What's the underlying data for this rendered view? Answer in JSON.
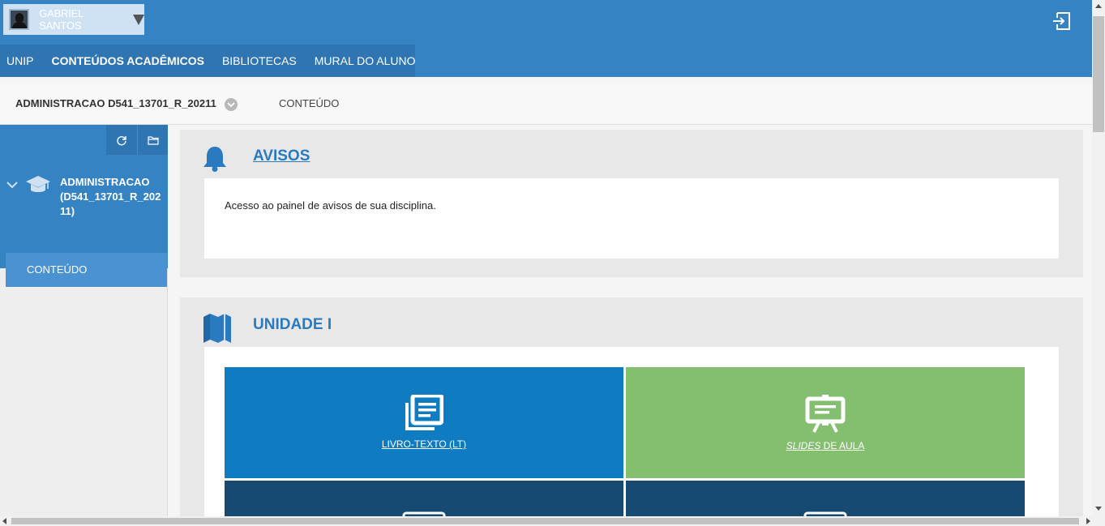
{
  "header": {
    "user_name": "GABRIEL SANTOS",
    "nav": [
      {
        "label": "UNIP"
      },
      {
        "label": "CONTEÚDOS ACADÊMICOS"
      },
      {
        "label": "BIBLIOTECAS"
      },
      {
        "label": "MURAL DO ALUNO"
      }
    ],
    "icons": {
      "logout": "logout-icon",
      "user_menu": "caret-down-icon"
    }
  },
  "breadcrumb": {
    "course": "ADMINISTRACAO D541_13701_R_20211",
    "section": "CONTEÚDO"
  },
  "sidebar": {
    "tools": [
      "refresh-icon",
      "folder-icon"
    ],
    "course_title": "ADMINISTRACAO (D541_13701_R_20211)",
    "items": [
      {
        "label": "CONTEÚDO"
      }
    ]
  },
  "main": {
    "avisos": {
      "title": "AVISOS",
      "description": "Acesso ao painel de avisos de sua disciplina."
    },
    "unidade": {
      "title": "UNIDADE I",
      "tiles": [
        {
          "label": "LIVRO-TEXTO (LT)",
          "color": "#0f7bc1"
        },
        {
          "label_italic": "SLIDES",
          "label_rest": " DE AULA",
          "color": "#83bf6e"
        }
      ]
    }
  },
  "colors": {
    "header": "#3683c4",
    "nav": "#2f75b2",
    "accent": "#2a7ac0",
    "dark_tile": "#174a73"
  }
}
